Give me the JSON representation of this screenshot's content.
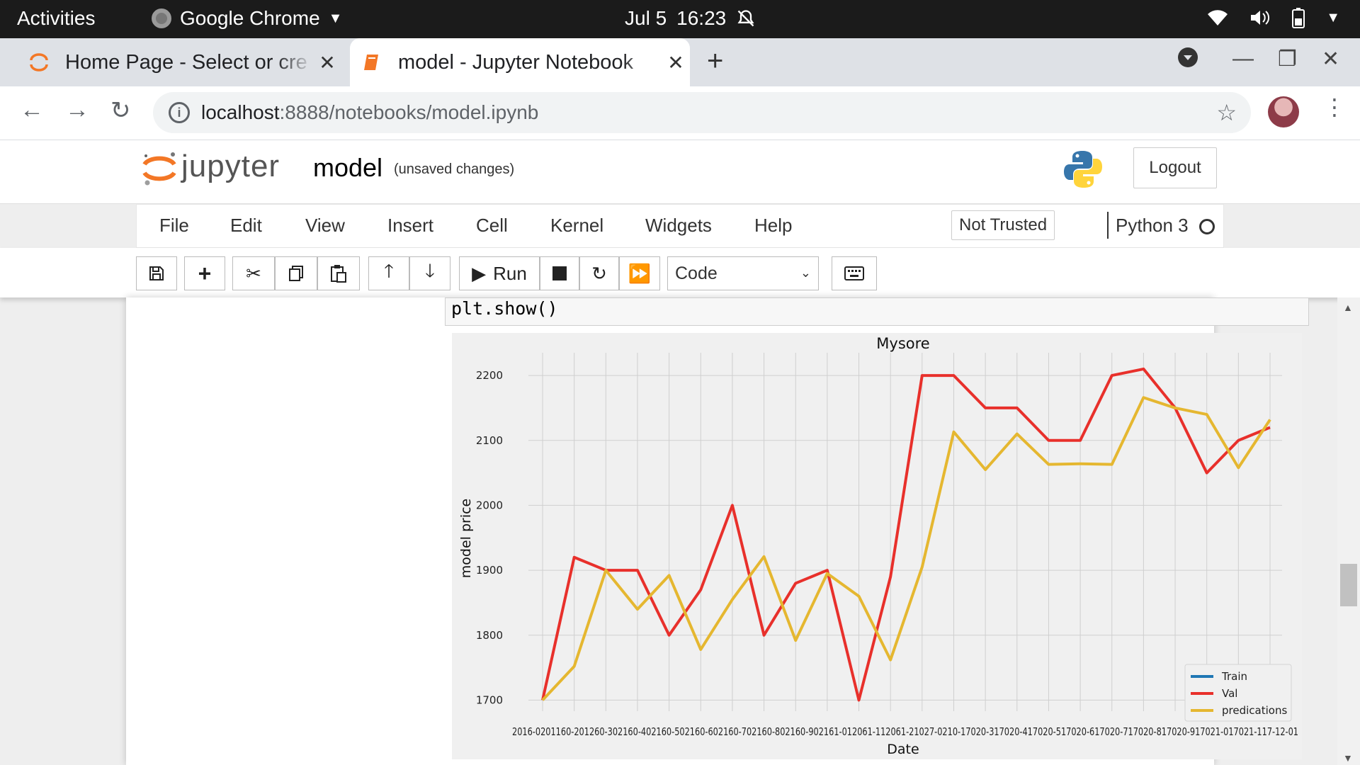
{
  "os": {
    "activities": "Activities",
    "app_name": "Google Chrome",
    "date": "Jul 5",
    "time": "16:23"
  },
  "browser": {
    "tabs": [
      {
        "title": "Home Page - Select or cre",
        "active": false
      },
      {
        "title": "model - Jupyter Notebook",
        "active": true
      }
    ],
    "url_host": "localhost",
    "url_path": ":8888/notebooks/model.ipynb"
  },
  "jupyter": {
    "brand": "jupyter",
    "notebook_name": "model",
    "save_status": "(unsaved changes)",
    "logout_label": "Logout",
    "menu": [
      "File",
      "Edit",
      "View",
      "Insert",
      "Cell",
      "Kernel",
      "Widgets",
      "Help"
    ],
    "trust_label": "Not Trusted",
    "kernel_name": "Python 3",
    "run_label": "Run",
    "cell_type": "Code",
    "code_line": "plt.show()"
  },
  "chart_data": {
    "type": "line",
    "title": "Mysore",
    "xlabel": "Date",
    "ylabel": "model price",
    "ylim": [
      1683,
      2235
    ],
    "yticks": [
      1700,
      1800,
      1900,
      2000,
      2100,
      2200
    ],
    "x": [
      "2016-01-01",
      "2016-02-01",
      "2016-03-01",
      "2016-04-01",
      "2016-05-01",
      "2016-06-01",
      "2016-07-01",
      "2016-08-01",
      "2016-09-01",
      "2016-10-01",
      "2016-11-01",
      "2016-12-01",
      "2017-01-01",
      "2017-02-01",
      "2017-03-01",
      "2017-04-01",
      "2017-05-01",
      "2017-06-01",
      "2017-07-01",
      "2017-08-01",
      "2017-09-01",
      "2017-10-01",
      "2017-11-01",
      "2017-12-01"
    ],
    "xtick_labels_text": "2016-0201160-201260-302160-402160-502160-602160-702160-802160-902161-012061-112061-21027-0210-17020-317020-417020-517020-617020-717020-817020-917021-017021-117-12-01",
    "series": [
      {
        "name": "Train",
        "color": "#1f77b4",
        "values": []
      },
      {
        "name": "Val",
        "color": "#e8302b",
        "values": [
          1700,
          1920,
          1900,
          1900,
          1800,
          1870,
          2000,
          1800,
          1880,
          1900,
          1700,
          1890,
          2200,
          2200,
          2150,
          2150,
          2100,
          2100,
          2200,
          2210,
          2150,
          2050,
          2100,
          2120
        ]
      },
      {
        "name": "predications",
        "color": "#e5b730",
        "values": [
          1700,
          1752,
          1900,
          1840,
          1892,
          1778,
          1855,
          1921,
          1792,
          1895,
          1860,
          1762,
          1905,
          2113,
          2055,
          2110,
          2063,
          2064,
          2063,
          2166,
          2150,
          2140,
          2058,
          2132
        ]
      }
    ],
    "legend_position": "lower-right",
    "grid": true
  }
}
